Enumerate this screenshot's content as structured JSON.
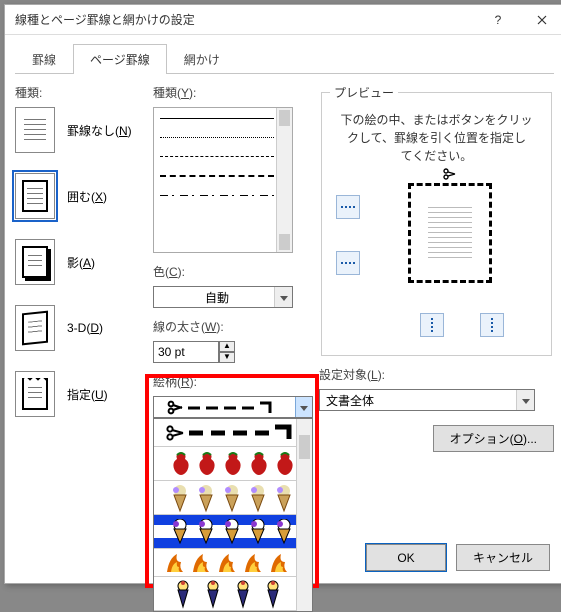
{
  "dialog": {
    "title": "線種とページ罫線と網かけの設定"
  },
  "tabs": {
    "borders": "罫線",
    "page_borders": "ページ罫線",
    "shading": "網かけ"
  },
  "col1": {
    "label": "種類:",
    "items": {
      "none": {
        "label": "罫線なし(",
        "key": "N",
        "suffix": ")"
      },
      "box": {
        "label": "囲む(",
        "key": "X",
        "suffix": ")"
      },
      "shadow": {
        "label": "影(",
        "key": "A",
        "suffix": ")"
      },
      "d3": {
        "label": "3-D(",
        "key": "D",
        "suffix": ")"
      },
      "custom": {
        "label": "指定(",
        "key": "U",
        "suffix": ")"
      }
    }
  },
  "col2": {
    "style_label": "種類(",
    "style_key": "Y",
    "style_suffix": "):",
    "color_label": "色(",
    "color_key": "C",
    "color_suffix": "):",
    "color_value": "自動",
    "width_label": "線の太さ(",
    "width_key": "W",
    "width_suffix": "):",
    "width_value": "30 pt",
    "art_label": "絵柄(",
    "art_key": "R",
    "art_suffix": "):",
    "art_options_semantic": [
      "scissor-dash",
      "strawberries",
      "ice-creams-1",
      "ice-creams-stripe",
      "flames",
      "ice-creams-2"
    ]
  },
  "col3": {
    "preview_legend": "プレビュー",
    "preview_help_1": "下の絵の中、またはボタンをクリッ",
    "preview_help_2": "クして、罫線を引く位置を指定し",
    "preview_help_3": "てください。",
    "apply_label": "設定対象(",
    "apply_key": "L",
    "apply_suffix": "):",
    "apply_value": "文書全体",
    "options_label": "オプション(",
    "options_key": "O",
    "options_suffix": ")..."
  },
  "footer": {
    "ok": "OK",
    "cancel": "キャンセル"
  }
}
